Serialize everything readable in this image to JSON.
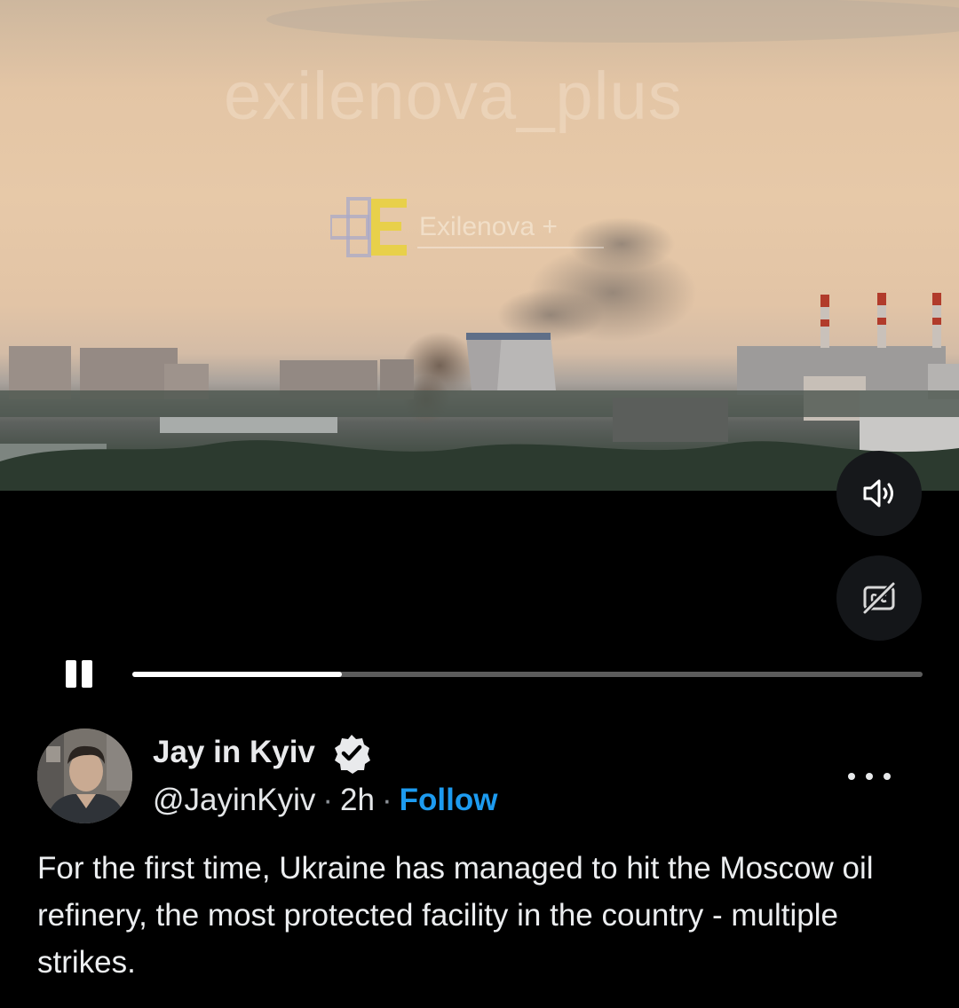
{
  "video": {
    "watermark_text": "exilenova_plus",
    "watermark_brand": "Exilenova +",
    "progress_fraction": 0.265
  },
  "controls": {
    "volume_icon": "speaker-volume-icon",
    "captions_icon": "closed-captions-off-icon",
    "pause_icon": "pause-icon"
  },
  "tweet": {
    "display_name": "Jay in Kyiv",
    "handle": "@JayinKyiv",
    "separator": "·",
    "time": "2h",
    "follow_label": "Follow",
    "more_icon": "more-options-icon",
    "verified_icon": "verified-badge-icon",
    "text": "For the first time, Ukraine has managed to hit the Moscow oil refinery, the most protected facility in the country - multiple strikes."
  },
  "colors": {
    "accent": "#1d9bf0",
    "background": "#000000",
    "progress_fill": "#ffffff",
    "progress_track": "#5c5c5c"
  }
}
